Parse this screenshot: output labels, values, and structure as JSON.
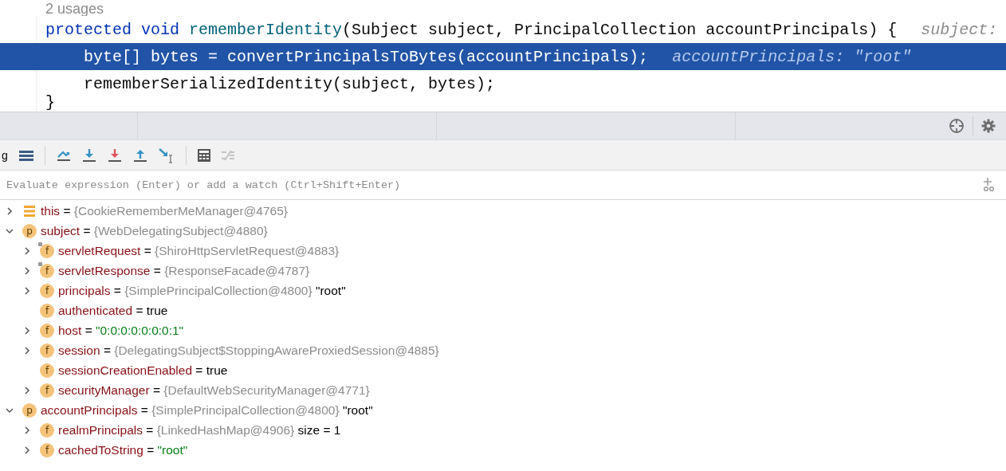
{
  "editor": {
    "usages": "2 usages",
    "lines": [
      {
        "selected": false,
        "tokens": [
          {
            "kind": "keyword",
            "text": "protected void "
          },
          {
            "kind": "method",
            "text": "rememberIdentity"
          },
          {
            "kind": "plain",
            "text": "(Subject subject, PrincipalCollection accountPrincipals) {"
          }
        ],
        "hint": "subject:"
      },
      {
        "selected": true,
        "tokens": [
          {
            "kind": "plain",
            "text": "    byte[] bytes = convertPrincipalsToBytes(accountPrincipals);"
          }
        ],
        "hint": "accountPrincipals: \"root\""
      },
      {
        "selected": false,
        "tokens": [
          {
            "kind": "plain",
            "text": "    rememberSerializedIdentity(subject, bytes);"
          }
        ]
      },
      {
        "selected": false,
        "tokens": [
          {
            "kind": "plain",
            "text": "}"
          }
        ]
      }
    ]
  },
  "toolbar": {
    "label": "g"
  },
  "evaluate": {
    "placeholder": "Evaluate expression (Enter) or add a watch (Ctrl+Shift+Enter)"
  },
  "variables": [
    {
      "kind": "this",
      "name": "this",
      "operator": "=",
      "value": {
        "kind": "object",
        "text": "{CookieRememberMeManager@4765}"
      },
      "expanded": false
    },
    {
      "kind": "parameter",
      "badge": "p",
      "name": "subject",
      "operator": "=",
      "value": {
        "kind": "object",
        "text": "{WebDelegatingSubject@4880}"
      },
      "expanded": true,
      "children": [
        {
          "kind": "annotated",
          "badge": "f",
          "name": "servletRequest",
          "operator": "=",
          "value": {
            "kind": "object",
            "text": "{ShiroHttpServletRequest@4883}"
          },
          "expanded": false
        },
        {
          "kind": "annotated",
          "badge": "f",
          "name": "servletResponse",
          "operator": "=",
          "value": {
            "kind": "object",
            "text": "{ResponseFacade@4787}"
          },
          "expanded": false
        },
        {
          "kind": "field",
          "badge": "f",
          "name": "principals",
          "operator": "=",
          "value": {
            "kind": "object",
            "text": "{SimplePrincipalCollection@4800}"
          },
          "suffix": "\"root\"",
          "expanded": false
        },
        {
          "kind": "field",
          "badge": "f",
          "name": "authenticated",
          "operator": "=",
          "value": {
            "kind": "literal",
            "text": "true"
          }
        },
        {
          "kind": "field",
          "badge": "f",
          "name": "host",
          "operator": "=",
          "value": {
            "kind": "string",
            "text": "\"0:0:0:0:0:0:0:1\""
          },
          "expanded": false
        },
        {
          "kind": "field",
          "badge": "f",
          "name": "session",
          "operator": "=",
          "value": {
            "kind": "object",
            "text": "{DelegatingSubject$StoppingAwareProxiedSession@4885}"
          },
          "expanded": false
        },
        {
          "kind": "field",
          "badge": "f",
          "name": "sessionCreationEnabled",
          "operator": "=",
          "value": {
            "kind": "literal",
            "text": "true"
          }
        },
        {
          "kind": "field",
          "badge": "f",
          "name": "securityManager",
          "operator": "=",
          "value": {
            "kind": "object",
            "text": "{DefaultWebSecurityManager@4771}"
          },
          "expanded": false
        }
      ]
    },
    {
      "kind": "parameter",
      "badge": "p",
      "name": "accountPrincipals",
      "operator": "=",
      "value": {
        "kind": "object",
        "text": "{SimplePrincipalCollection@4800}"
      },
      "suffix": "\"root\"",
      "expanded": true,
      "children": [
        {
          "kind": "field",
          "badge": "f",
          "name": "realmPrincipals",
          "operator": "=",
          "value": {
            "kind": "object",
            "text": "{LinkedHashMap@4906}"
          },
          "suffix": "size = 1",
          "expanded": false
        },
        {
          "kind": "field",
          "badge": "f",
          "name": "cachedToString",
          "operator": "=",
          "value": {
            "kind": "string",
            "text": "\"root\""
          },
          "expanded": false
        }
      ]
    }
  ]
}
